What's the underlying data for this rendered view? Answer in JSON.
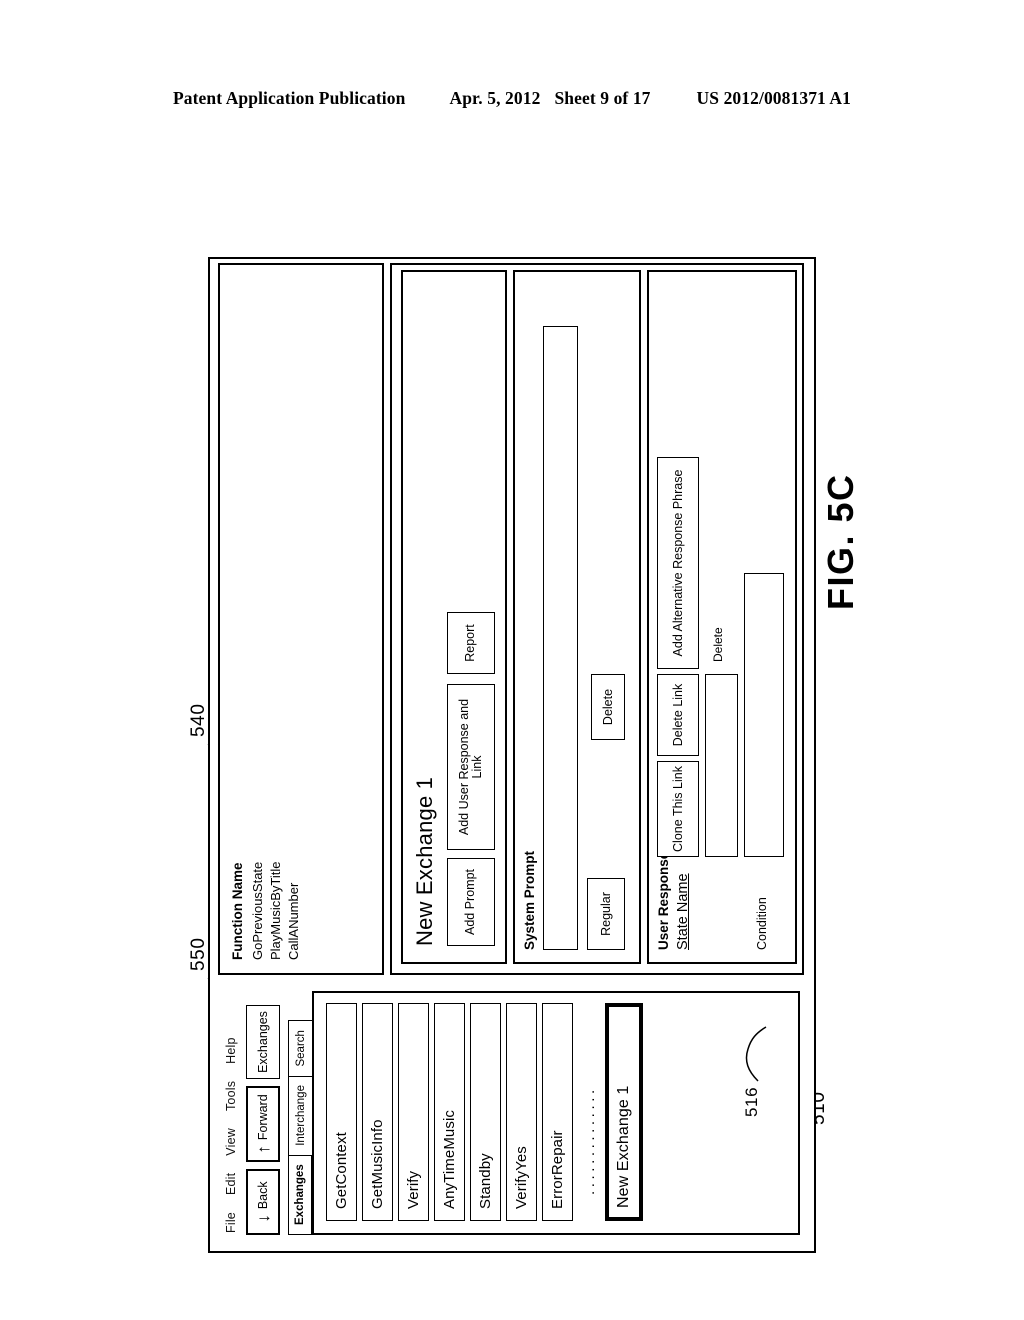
{
  "patent_header": {
    "publication": "Patent Application Publication",
    "date": "Apr. 5, 2012",
    "sheet": "Sheet 9 of 17",
    "number": "US 2012/0081371 A1"
  },
  "figure": {
    "label": "FIG. 5C",
    "reference_numerals": {
      "window": "510",
      "highlighted_exchange": "516",
      "exchange_header_section": "540",
      "editor_panel": "550"
    }
  },
  "app": {
    "menubar": [
      "File",
      "Edit",
      "View",
      "Tools",
      "Help"
    ],
    "toolbar": [
      {
        "label": "Back",
        "icon": "arrow-down-icon"
      },
      {
        "label": "Forward",
        "icon": "arrow-up-icon"
      },
      {
        "label": "Exchanges",
        "icon": ""
      }
    ],
    "tabs": [
      {
        "label": "Exchanges",
        "selected": true
      },
      {
        "label": "Interchange",
        "selected": false
      },
      {
        "label": "Search",
        "selected": false
      }
    ],
    "exchange_list": [
      "GetContext",
      "GetMusicInfo",
      "Verify",
      "AnyTimeMusic",
      "Standby",
      "VerifyYes",
      "ErrorRepair"
    ],
    "exchange_list_ellipsis": "..............",
    "highlighted_exchange": "New Exchange 1"
  },
  "function_panel": {
    "header": "Function Name",
    "items": [
      "GoPreviousState",
      "PlayMusicByTitle",
      "CallANumber"
    ]
  },
  "editor": {
    "exchange_title": "New Exchange 1",
    "buttons": {
      "add_prompt": "Add Prompt",
      "add_user_response": "Add User Response and Link",
      "report": "Report"
    },
    "system_prompt": {
      "label": "System Prompt",
      "field_value": "",
      "regular_button": "Regular",
      "delete_button": "Delete"
    },
    "user_response": {
      "label": "User Response and Link",
      "state_name_label": "State Name",
      "clone_button": "Clone This Link",
      "delete_link_button": "Delete Link",
      "add_alternative_button": "Add Alternative Response Phrase",
      "delete_label": "Delete",
      "condition_label": "Condition",
      "phrase_field_value": "",
      "condition_field_value": ""
    }
  }
}
